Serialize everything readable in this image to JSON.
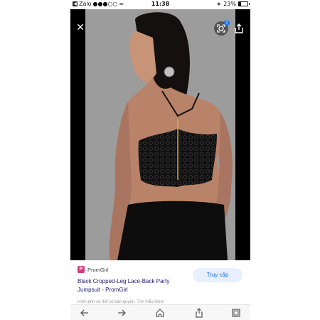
{
  "status_bar": {
    "carrier": "Zalo",
    "signal": "●●●○○",
    "time": "11:38",
    "battery_text": "23%",
    "battery_level": 0.23
  },
  "photo": {
    "close_icon": "close-icon",
    "lens_badge_count": "2",
    "share_icon": "share-icon"
  },
  "card": {
    "source_icon_letter": "P",
    "source_name": "PromGirl",
    "title": "Black Cropped-Leg Lace-Back Party Jumpsuit - PromGirl",
    "visit_label": "Truy cập",
    "disclaimer": "Hình ảnh có thể có bản quyền. Tìm hiểu thêm"
  },
  "toolbar": {
    "back_icon": "arrow-left-icon",
    "forward_icon": "arrow-right-icon",
    "home_icon": "home-icon",
    "share_icon": "share-icon",
    "tabs_icon": "tabs-icon"
  },
  "colors": {
    "accent": "#1a73e8",
    "source_brand": "#d63a7c",
    "title_link": "#1a1a6e"
  }
}
